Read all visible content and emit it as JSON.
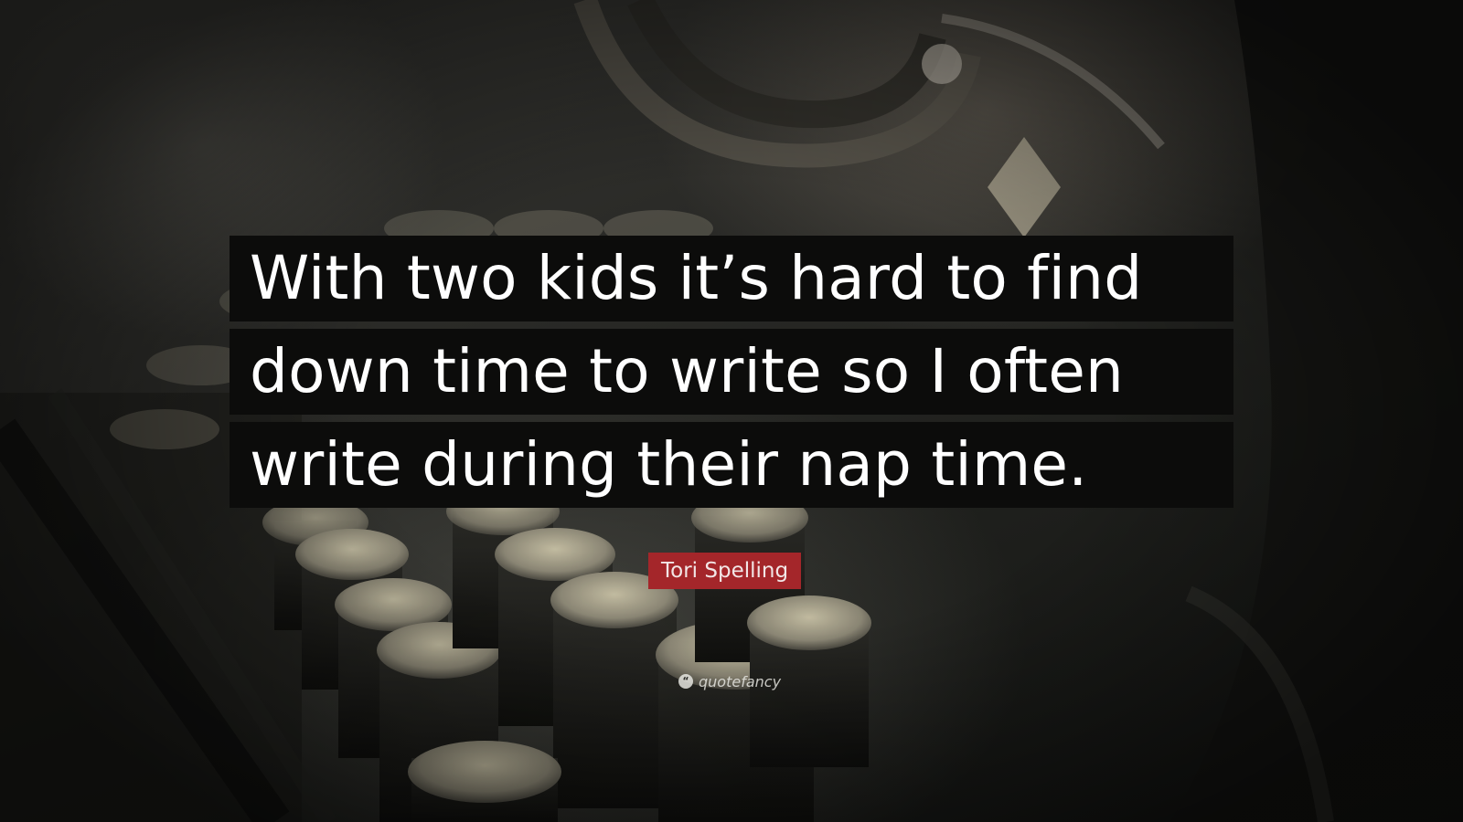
{
  "quote": {
    "lines": [
      "With two kids it’s hard to find",
      "down time to write so I often",
      "write during their nap time."
    ]
  },
  "author": {
    "name": "Tori Spelling"
  },
  "watermark": {
    "icon": "quote-marks-icon",
    "text": "quotefancy"
  },
  "colors": {
    "quote_background": "#0c0c0b",
    "quote_text": "#ffffff",
    "author_badge": "#a4262a"
  }
}
